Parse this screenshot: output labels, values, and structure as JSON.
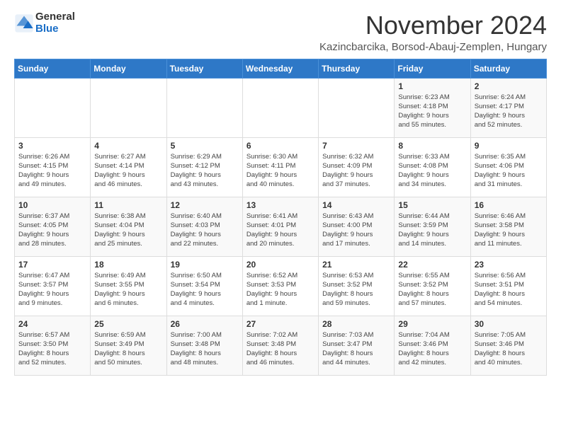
{
  "header": {
    "logo_general": "General",
    "logo_blue": "Blue",
    "month_title": "November 2024",
    "subtitle": "Kazincbarcika, Borsod-Abauj-Zemplen, Hungary"
  },
  "days_of_week": [
    "Sunday",
    "Monday",
    "Tuesday",
    "Wednesday",
    "Thursday",
    "Friday",
    "Saturday"
  ],
  "weeks": [
    [
      {
        "day": "",
        "info": ""
      },
      {
        "day": "",
        "info": ""
      },
      {
        "day": "",
        "info": ""
      },
      {
        "day": "",
        "info": ""
      },
      {
        "day": "",
        "info": ""
      },
      {
        "day": "1",
        "info": "Sunrise: 6:23 AM\nSunset: 4:18 PM\nDaylight: 9 hours\nand 55 minutes."
      },
      {
        "day": "2",
        "info": "Sunrise: 6:24 AM\nSunset: 4:17 PM\nDaylight: 9 hours\nand 52 minutes."
      }
    ],
    [
      {
        "day": "3",
        "info": "Sunrise: 6:26 AM\nSunset: 4:15 PM\nDaylight: 9 hours\nand 49 minutes."
      },
      {
        "day": "4",
        "info": "Sunrise: 6:27 AM\nSunset: 4:14 PM\nDaylight: 9 hours\nand 46 minutes."
      },
      {
        "day": "5",
        "info": "Sunrise: 6:29 AM\nSunset: 4:12 PM\nDaylight: 9 hours\nand 43 minutes."
      },
      {
        "day": "6",
        "info": "Sunrise: 6:30 AM\nSunset: 4:11 PM\nDaylight: 9 hours\nand 40 minutes."
      },
      {
        "day": "7",
        "info": "Sunrise: 6:32 AM\nSunset: 4:09 PM\nDaylight: 9 hours\nand 37 minutes."
      },
      {
        "day": "8",
        "info": "Sunrise: 6:33 AM\nSunset: 4:08 PM\nDaylight: 9 hours\nand 34 minutes."
      },
      {
        "day": "9",
        "info": "Sunrise: 6:35 AM\nSunset: 4:06 PM\nDaylight: 9 hours\nand 31 minutes."
      }
    ],
    [
      {
        "day": "10",
        "info": "Sunrise: 6:37 AM\nSunset: 4:05 PM\nDaylight: 9 hours\nand 28 minutes."
      },
      {
        "day": "11",
        "info": "Sunrise: 6:38 AM\nSunset: 4:04 PM\nDaylight: 9 hours\nand 25 minutes."
      },
      {
        "day": "12",
        "info": "Sunrise: 6:40 AM\nSunset: 4:03 PM\nDaylight: 9 hours\nand 22 minutes."
      },
      {
        "day": "13",
        "info": "Sunrise: 6:41 AM\nSunset: 4:01 PM\nDaylight: 9 hours\nand 20 minutes."
      },
      {
        "day": "14",
        "info": "Sunrise: 6:43 AM\nSunset: 4:00 PM\nDaylight: 9 hours\nand 17 minutes."
      },
      {
        "day": "15",
        "info": "Sunrise: 6:44 AM\nSunset: 3:59 PM\nDaylight: 9 hours\nand 14 minutes."
      },
      {
        "day": "16",
        "info": "Sunrise: 6:46 AM\nSunset: 3:58 PM\nDaylight: 9 hours\nand 11 minutes."
      }
    ],
    [
      {
        "day": "17",
        "info": "Sunrise: 6:47 AM\nSunset: 3:57 PM\nDaylight: 9 hours\nand 9 minutes."
      },
      {
        "day": "18",
        "info": "Sunrise: 6:49 AM\nSunset: 3:55 PM\nDaylight: 9 hours\nand 6 minutes."
      },
      {
        "day": "19",
        "info": "Sunrise: 6:50 AM\nSunset: 3:54 PM\nDaylight: 9 hours\nand 4 minutes."
      },
      {
        "day": "20",
        "info": "Sunrise: 6:52 AM\nSunset: 3:53 PM\nDaylight: 9 hours\nand 1 minute."
      },
      {
        "day": "21",
        "info": "Sunrise: 6:53 AM\nSunset: 3:52 PM\nDaylight: 8 hours\nand 59 minutes."
      },
      {
        "day": "22",
        "info": "Sunrise: 6:55 AM\nSunset: 3:52 PM\nDaylight: 8 hours\nand 57 minutes."
      },
      {
        "day": "23",
        "info": "Sunrise: 6:56 AM\nSunset: 3:51 PM\nDaylight: 8 hours\nand 54 minutes."
      }
    ],
    [
      {
        "day": "24",
        "info": "Sunrise: 6:57 AM\nSunset: 3:50 PM\nDaylight: 8 hours\nand 52 minutes."
      },
      {
        "day": "25",
        "info": "Sunrise: 6:59 AM\nSunset: 3:49 PM\nDaylight: 8 hours\nand 50 minutes."
      },
      {
        "day": "26",
        "info": "Sunrise: 7:00 AM\nSunset: 3:48 PM\nDaylight: 8 hours\nand 48 minutes."
      },
      {
        "day": "27",
        "info": "Sunrise: 7:02 AM\nSunset: 3:48 PM\nDaylight: 8 hours\nand 46 minutes."
      },
      {
        "day": "28",
        "info": "Sunrise: 7:03 AM\nSunset: 3:47 PM\nDaylight: 8 hours\nand 44 minutes."
      },
      {
        "day": "29",
        "info": "Sunrise: 7:04 AM\nSunset: 3:46 PM\nDaylight: 8 hours\nand 42 minutes."
      },
      {
        "day": "30",
        "info": "Sunrise: 7:05 AM\nSunset: 3:46 PM\nDaylight: 8 hours\nand 40 minutes."
      }
    ]
  ]
}
